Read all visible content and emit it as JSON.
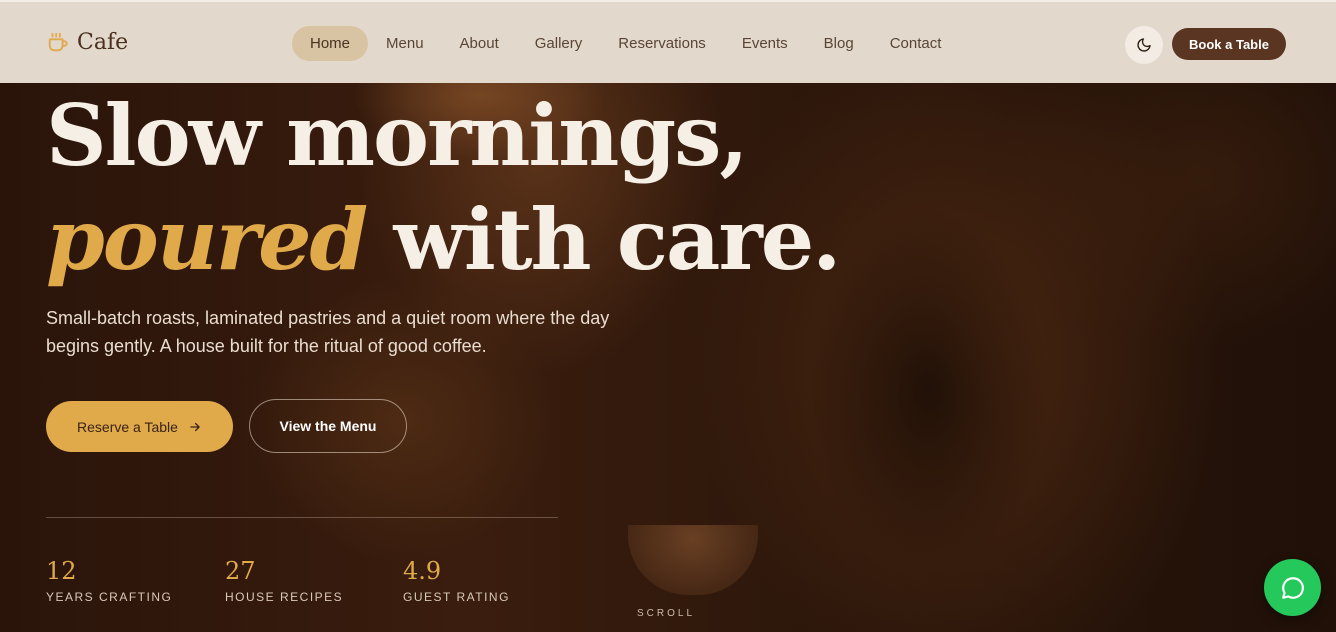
{
  "brand": {
    "name": "Cafe",
    "icon": "coffee-cup-icon"
  },
  "nav": {
    "items": [
      {
        "label": "Home",
        "active": true
      },
      {
        "label": "Menu"
      },
      {
        "label": "About"
      },
      {
        "label": "Gallery"
      },
      {
        "label": "Reservations"
      },
      {
        "label": "Events"
      },
      {
        "label": "Blog"
      },
      {
        "label": "Contact"
      }
    ],
    "theme_toggle_icon": "moon-icon",
    "cta_label": "Book a Table"
  },
  "hero": {
    "line1": "Slow mornings,",
    "line2_accent": "poured",
    "line2_rest": " with care.",
    "subcopy": "Small-batch roasts, laminated pastries and a quiet room where the day begins gently. A house built for the ritual of good coffee.",
    "primary_cta": "Reserve a Table",
    "primary_cta_icon": "arrow-right-icon",
    "secondary_cta": "View the Menu"
  },
  "stats": [
    {
      "value": "12",
      "label": "YEARS CRAFTING"
    },
    {
      "value": "27",
      "label": "HOUSE RECIPES"
    },
    {
      "value": "4.9",
      "label": "GUEST RATING"
    }
  ],
  "scroll_label": "SCROLL",
  "chat": {
    "icon": "chat-bubble-icon"
  },
  "colors": {
    "accent": "#e0a94a",
    "nav_bg": "#e2d8cc",
    "cta_dark": "#5a3521",
    "chat_green": "#25c85a"
  }
}
